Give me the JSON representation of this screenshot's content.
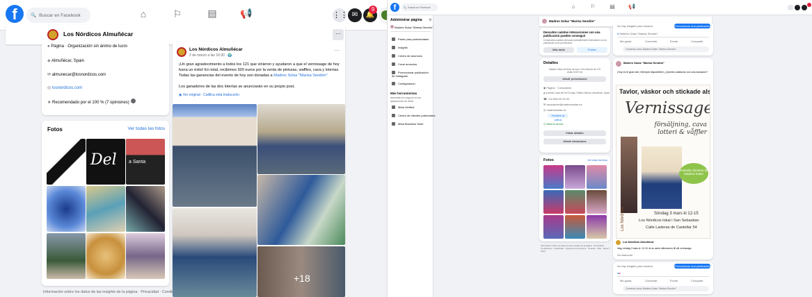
{
  "left": {
    "search_placeholder": "Buscar en Facebook",
    "notification_count": "9",
    "page_name": "Los Nórdicos Almuñécar",
    "more_label": "···",
    "intro": {
      "category": "Página · Organización sin ánimo de lucro",
      "location": "Almuñécar, Spain",
      "email": "almunecar@losnordicos.com",
      "website": "losnordicos.com",
      "recommended": "Recomendado por el 100 % (7 opiniones)"
    },
    "photos": {
      "title": "Fotos",
      "see_all": "Ver todas las fotos",
      "tile_text_1": "Del",
      "tile_text_2": "a Santa"
    },
    "footer": "Información sobre los datos de las insights de la página · Privacidad · Condiciones ·",
    "post": {
      "author": "Los Nórdicos Almuñécar",
      "time": "2 de marzo a las 16:30 · 🌍",
      "body": "¡Un gran agradecimiento a todos los 121 que vinieron y ayudaron a que el vernissage de hoy fuera un éxito! En total, recibimos 920 euros por la venta de pinturas, waffles, cava y loterías. Todas las ganancias del evento de hoy son donadas a",
      "mention": "Madres Solas \"Marisa Sendón\"",
      "line2": "Los ganadores de las dos loterías se anunciarán en su propio post.",
      "translation": "Ver original · Califica esta traducción",
      "more_photos": "+18"
    }
  },
  "right": {
    "search_placeholder": "Buscar en Facebook",
    "admin_title": "Administrar página",
    "admin_page": "Madres Solas \"Marisa Sendón\"",
    "menu": [
      "Panel para profesionales",
      "Insights",
      "Centro de anuncios",
      "Crear anuncios",
      "Promocionar publicación de Instagram",
      "Configuración"
    ],
    "tools_title": "Más herramientas",
    "tools_sub": "Administra tu negocio en las aplicaciones de Meta",
    "tools": [
      "Meta Verified",
      "Centro de clientes potenciales",
      "Meta Business Suite"
    ],
    "cover_name": "Madres Solas \"Marisa Sendón\"",
    "discover_title": "Descubre cuántas interacciones con una publicación pueden conseguir",
    "discover_sub": "Comprueba cuántas personas probablemente interactúen con tu publicación si se promociona.",
    "btn_more": "Más tarde",
    "btn_try": "Probar",
    "details_title": "Detalles",
    "details_sub": "Madres Solas sin fines de lucro 100 millones de 175 vistas 9.000 me",
    "btn_add_presentation": "Añadir presentación",
    "detail_lines": [
      "Página · Consultorio",
      "Avenida Costa del Sol 15 bajo, Edificio Marina, Almuñécar, Spain",
      "+34 666 00 00 00",
      "asociacion@madressolas.es",
      "madressolas.es",
      "Pendiente de calificar",
      "Abierto ahora"
    ],
    "btn_edit_details": "Editar detalles",
    "btn_add_featured": "Añadir destacados",
    "photos_title": "Fotos",
    "photos_see_all": "Ver todas las fotos",
    "footer": "Información sobre los datos de las insights de la página · Privacidad · Condiciones · Publicidad · Opciones de anuncios · Cookies · Más · Meta © 2024",
    "promote_label": "Promocionar una publicación",
    "reach_text": "No hay insights para mostrar",
    "actions": [
      "Me gusta",
      "Comentar",
      "Enviar",
      "Compartir"
    ],
    "comment_placeholder": "Comenta como Madres Solas \"Marisa Sendón\"",
    "shared_author": "Madres Solas \"Marisa Sendón\"",
    "shared_text": "¡Hoy es el gran día! ¡Siempre disponibles! ¿Quieres colaborar con una donación?",
    "poster": {
      "headline": "Tavlor, väskor och stickade alster",
      "title": "Vernissage",
      "subtitle": "försäljning, cava lotteri & våffler",
      "green_badge": "Insamlar donerus till Madres Solas",
      "date_line": "Söndag 3 mars kl 12-15",
      "place_line": "Los Nórdicos lokal i San Sebastian",
      "street_line": "Calle Laderas de Castellar 54",
      "org_vertical": "Los Nórdicos"
    },
    "under_poster_author": "Los Nórdicos Almuñécar",
    "under_poster_text": "Idag, söndag 3 mars kl. 12-15, är du varmt välkommen till vår vernissage…",
    "see_translation": "Ver traducción"
  }
}
